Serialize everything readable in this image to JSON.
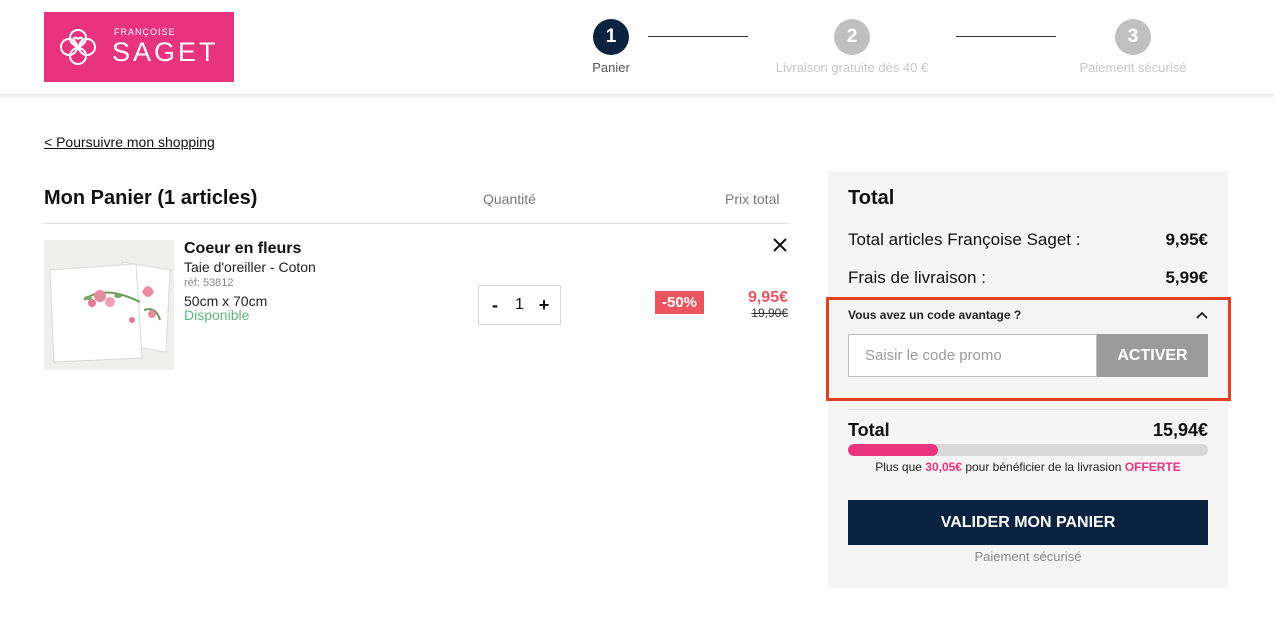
{
  "header": {
    "brand_small": "FRANÇOISE",
    "brand_big": "SAGET",
    "steps": [
      {
        "number": "1",
        "label": "Panier",
        "state": "active"
      },
      {
        "number": "2",
        "label": "Livraison gratuite dès 40 €",
        "state": "inactive"
      },
      {
        "number": "3",
        "label": "Paiement sécurisé",
        "state": "inactive"
      }
    ]
  },
  "back_link": "< Poursuivre mon shopping",
  "cart": {
    "title": "Mon Panier (1 articles)",
    "col_quantity": "Quantité",
    "col_total": "Prix total",
    "item": {
      "name": "Coeur en fleurs",
      "type": "Taie d'oreiller - Coton",
      "ref": "réf: 53812",
      "size": "50cm x 70cm",
      "stock": "Disponible",
      "quantity": "1",
      "minus": "-",
      "plus": "+",
      "discount": "-50%",
      "price_new": "9,95€",
      "price_old": "19,90€"
    }
  },
  "summary": {
    "title": "Total",
    "items_label": "Total articles Françoise Saget :",
    "items_value": "9,95€",
    "shipping_label": "Frais de livraison :",
    "shipping_value": "5,99€",
    "promo_question": "Vous avez un code avantage ?",
    "promo_placeholder": "Saisir le code promo",
    "promo_button": "ACTIVER",
    "total_label": "Total",
    "total_value": "15,94€",
    "progress_fraction": 0.25,
    "ship_prefix": "Plus que",
    "ship_amount": "30,05€",
    "ship_middle": "pour bénéficier de la livrasion",
    "ship_offer": "OFFERTE",
    "validate_button": "VALIDER MON PANIER",
    "secure_note": "Paiement sécurisé"
  },
  "colors": {
    "brand_pink": "#e8337f",
    "navy": "#0b2341",
    "discount_red": "#ea5560",
    "highlight_orange": "#e2401f",
    "available_green": "#5fb677"
  }
}
